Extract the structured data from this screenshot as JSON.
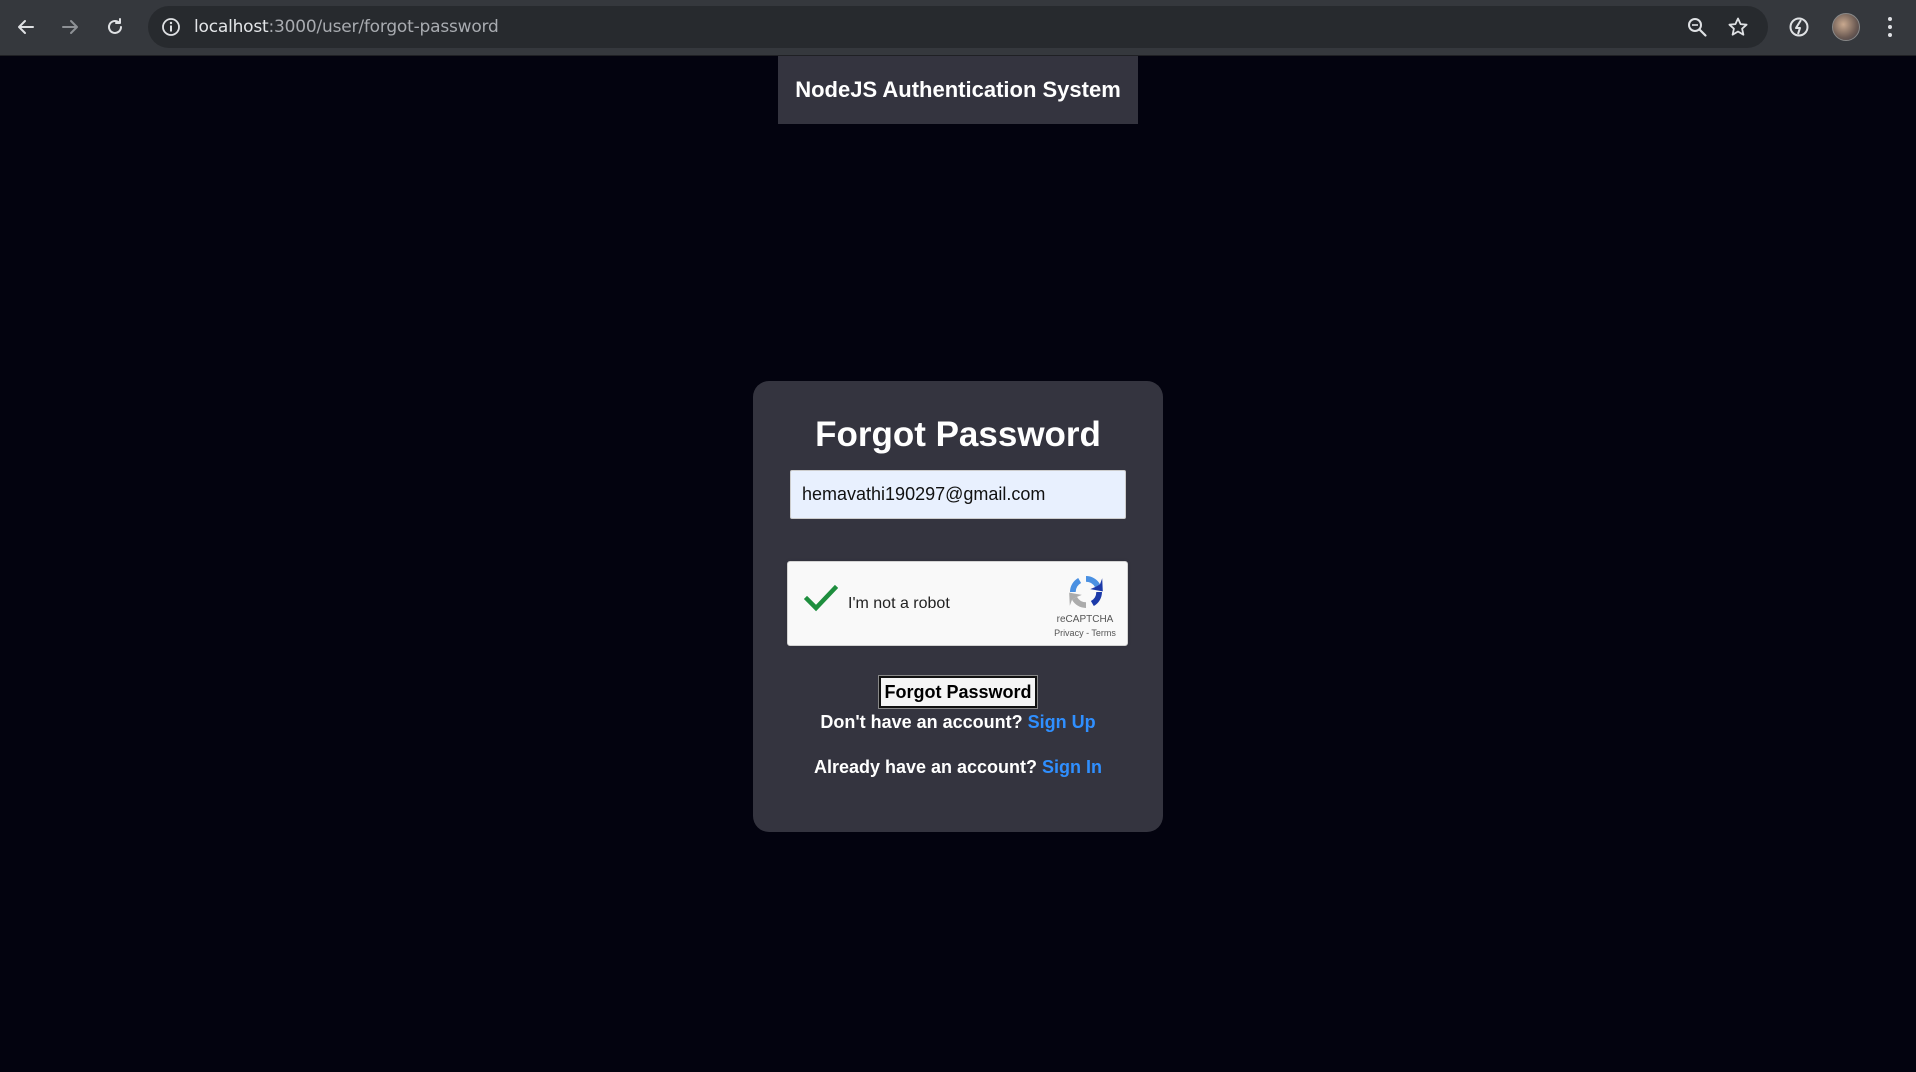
{
  "browser": {
    "url_host": "localhost",
    "url_path": ":3000/user/forgot-password",
    "icons": {
      "back": "arrow-left-icon",
      "forward": "arrow-right-icon",
      "reload": "reload-icon",
      "site_info": "info-icon",
      "zoom": "zoom-icon",
      "bookmark": "star-icon",
      "extension": "extension-icon",
      "profile": "avatar",
      "menu": "kebab-menu-icon"
    }
  },
  "header": {
    "title": "NodeJS Authentication System"
  },
  "form": {
    "title": "Forgot Password",
    "email_value": "hemavathi190297@gmail.com",
    "captcha": {
      "label": "I'm not a robot",
      "brand": "reCAPTCHA",
      "privacy": "Privacy",
      "separator": " - ",
      "terms": "Terms",
      "checked": true
    },
    "submit_label": "Forgot Password",
    "signup_prompt": "Don't have an account?",
    "signup_link": "Sign Up",
    "signin_prompt": "Already have an account?",
    "signin_link": "Sign In"
  },
  "colors": {
    "page_bg": "#03030f",
    "card_bg": "#34343f",
    "link": "#2f8fff",
    "check": "#1e8e3e"
  }
}
